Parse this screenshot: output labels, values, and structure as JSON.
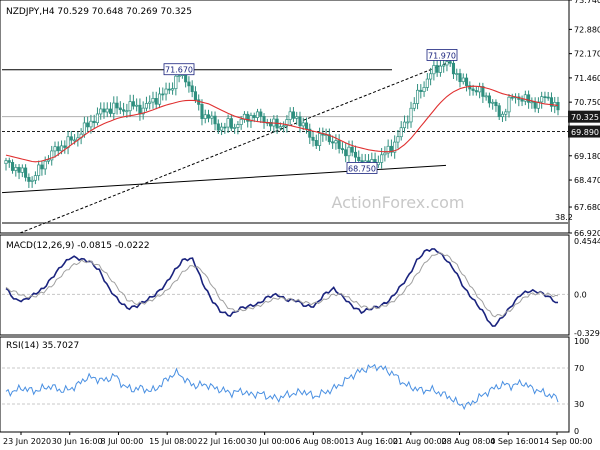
{
  "colors": {
    "background": "#ffffff",
    "price_bar": "#2f8f7f",
    "moving_average": "#e03030",
    "trendline": "#000000",
    "dotted_line": "#202020",
    "macd": "#1a237e",
    "macd_signal": "#a0a0a0",
    "rsi": "#4a90e2",
    "label_border": "#1a237e",
    "current_price_box": "#1a1a1a",
    "grid": "#c8c8c8"
  },
  "chart_data": [
    {
      "type": "candlestick",
      "title": "NZDJPY,H4  70.529 70.648 70.269 70.325",
      "watermark": "ActionForex.com",
      "ylim": [
        66.92,
        73.74
      ],
      "y_ticks": [
        "73.740",
        "72.880",
        "72.170",
        "71.460",
        "70.750",
        "70.325",
        "69.890",
        "69.180",
        "68.470",
        "67.680",
        "66.920"
      ],
      "annotations": [
        {
          "text": "71.670",
          "x": "22 Jul 08:00",
          "y": 71.67
        },
        {
          "text": "71.970",
          "x": "28 Aug 08:00",
          "y": 71.97
        },
        {
          "text": "68.750",
          "x": "19 Aug 00:00",
          "y": 68.75
        },
        {
          "text": "38.2",
          "x": "16 Sep",
          "y": 67.55
        }
      ],
      "current_price": 70.325,
      "level_line": 69.89,
      "horizontal_line": 71.7,
      "close_path": [
        68.95,
        68.9,
        68.75,
        68.6,
        68.45,
        68.7,
        69.0,
        69.2,
        69.4,
        69.5,
        69.6,
        69.7,
        69.9,
        70.1,
        70.3,
        70.45,
        70.55,
        70.6,
        70.5,
        70.6,
        70.65,
        70.55,
        70.6,
        70.8,
        70.9,
        71.0,
        71.2,
        71.5,
        71.6,
        71.2,
        70.7,
        70.4,
        70.3,
        70.1,
        70.0,
        70.1,
        70.05,
        70.2,
        70.3,
        70.4,
        70.3,
        70.2,
        70.1,
        70.0,
        70.2,
        70.35,
        70.3,
        70.0,
        69.7,
        69.6,
        69.8,
        69.7,
        69.5,
        69.3,
        69.4,
        69.1,
        69.0,
        68.9,
        69.0,
        69.1,
        69.3,
        69.5,
        69.8,
        70.2,
        70.6,
        71.0,
        71.3,
        71.6,
        71.75,
        71.9,
        71.8,
        71.6,
        71.3,
        71.2,
        71.1,
        71.0,
        70.9,
        70.6,
        70.3,
        70.7,
        70.9,
        70.9,
        70.8,
        70.7,
        70.75,
        70.9,
        70.8,
        70.5
      ],
      "moving_average_path": [
        69.2,
        69.15,
        69.1,
        69.05,
        69.0,
        69.02,
        69.08,
        69.15,
        69.3,
        69.45,
        69.6,
        69.75,
        69.9,
        70.02,
        70.12,
        70.2,
        70.28,
        70.33,
        70.36,
        70.4,
        70.45,
        70.52,
        70.6,
        70.67,
        70.72,
        70.78,
        70.8,
        70.8,
        70.75,
        70.7,
        70.6,
        70.5,
        70.4,
        70.32,
        70.26,
        70.22,
        70.18,
        70.16,
        70.14,
        70.13,
        70.1,
        70.05,
        70.0,
        69.95,
        69.9,
        69.85,
        69.8,
        69.72,
        69.62,
        69.52,
        69.45,
        69.4,
        69.35,
        69.32,
        69.3,
        69.3,
        69.35,
        69.5,
        69.7,
        69.95,
        70.2,
        70.45,
        70.7,
        70.9,
        71.05,
        71.15,
        71.2,
        71.22,
        71.2,
        71.15,
        71.08,
        71.0,
        70.95,
        70.9,
        70.85,
        70.8,
        70.75,
        70.7,
        70.68,
        70.65
      ]
    },
    {
      "type": "line",
      "title": "MACD(12,26,9)  -0.0815  -0.0222",
      "ylim": [
        -0.3291,
        0.4544
      ],
      "y_ticks": [
        "0.4544",
        "0.0",
        "-0.3291"
      ],
      "series": [
        {
          "values": [
            0.05,
            -0.05,
            -0.05,
            0.0,
            0.05,
            0.15,
            0.25,
            0.32,
            0.3,
            0.28,
            0.2,
            0.05,
            -0.05,
            -0.12,
            -0.1,
            -0.05,
            0.0,
            0.08,
            0.2,
            0.3,
            0.3,
            0.1,
            -0.05,
            -0.15,
            -0.18,
            -0.12,
            -0.1,
            -0.08,
            -0.02,
            0.0,
            -0.05,
            -0.05,
            -0.1,
            -0.1,
            0.0,
            0.05,
            -0.02,
            -0.1,
            -0.15,
            -0.12,
            -0.1,
            -0.05,
            0.05,
            0.15,
            0.3,
            0.38,
            0.38,
            0.3,
            0.2,
            0.05,
            -0.05,
            -0.15,
            -0.28,
            -0.2,
            -0.1,
            0.0,
            0.03,
            0.02,
            -0.02,
            -0.08
          ]
        },
        {
          "values": [
            0.05,
            0.02,
            -0.02,
            -0.02,
            0.02,
            0.08,
            0.17,
            0.24,
            0.28,
            0.28,
            0.24,
            0.15,
            0.05,
            -0.05,
            -0.08,
            -0.07,
            -0.03,
            0.02,
            0.1,
            0.2,
            0.25,
            0.2,
            0.08,
            -0.05,
            -0.13,
            -0.14,
            -0.12,
            -0.1,
            -0.06,
            -0.03,
            -0.04,
            -0.05,
            -0.07,
            -0.08,
            -0.05,
            0.0,
            0.0,
            -0.05,
            -0.1,
            -0.12,
            -0.11,
            -0.08,
            -0.02,
            0.07,
            0.18,
            0.29,
            0.35,
            0.34,
            0.27,
            0.15,
            0.03,
            -0.08,
            -0.18,
            -0.18,
            -0.13,
            -0.05,
            0.0,
            0.01,
            0.0,
            -0.02
          ]
        }
      ]
    },
    {
      "type": "line",
      "title": "RSI(14)  35.7027",
      "ylim": [
        0,
        100
      ],
      "y_ticks": [
        "100",
        "70",
        "30",
        "0"
      ],
      "reference_levels": [
        70,
        30
      ],
      "series": [
        {
          "values": [
            42,
            45,
            48,
            44,
            47,
            50,
            45,
            46,
            52,
            60,
            58,
            56,
            62,
            50,
            46,
            48,
            44,
            50,
            60,
            65,
            55,
            50,
            52,
            48,
            45,
            42,
            45,
            40,
            42,
            38,
            36,
            40,
            42,
            44,
            38,
            42,
            46,
            52,
            60,
            66,
            70,
            72,
            68,
            62,
            52,
            48,
            45,
            46,
            42,
            38,
            30,
            28,
            35,
            42,
            48,
            52,
            50,
            54,
            48,
            44,
            40,
            36
          ]
        }
      ]
    }
  ],
  "x_axis": {
    "tick_labels": [
      "23 Jun 2020",
      "30 Jun 16:00",
      "8 Jul 00:00",
      "15 Jul 08:00",
      "22 Jul 16:00",
      "30 Jul 00:00",
      "6 Aug 08:00",
      "13 Aug 16:00",
      "21 Aug 00:00",
      "28 Aug 08:00",
      "4 Sep 16:00",
      "14 Sep 00:00"
    ]
  }
}
